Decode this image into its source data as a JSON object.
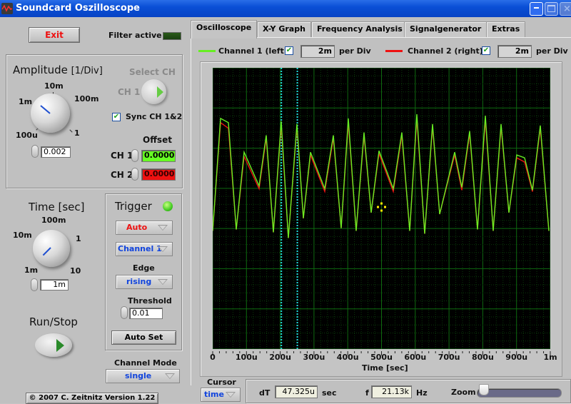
{
  "window": {
    "title": "Soundcard Oszilloscope",
    "minimize_icon": "minimize-icon",
    "maximize_icon": "maximize-icon",
    "close_icon": "close-icon"
  },
  "left_panel": {
    "exit_label": "Exit",
    "filter_label": "Filter active",
    "filter_active": false,
    "amplitude": {
      "title": "Amplitude",
      "unit": "[1/Div]",
      "knob_labels": [
        "100u",
        "1m",
        "10m",
        "100m",
        "1"
      ],
      "value": "0.002"
    },
    "select_ch": {
      "title": "Select CH",
      "value_label": "CH 1"
    },
    "sync": {
      "label": "Sync CH 1&2",
      "checked": true
    },
    "offset": {
      "title": "Offset",
      "ch1_label": "CH 1",
      "ch1_value": "0.0000",
      "ch1_color": "#66ff33",
      "ch2_label": "CH 2",
      "ch2_value": "0.0000",
      "ch2_color": "#ee1111"
    },
    "time": {
      "title": "Time [sec]",
      "knob_labels": [
        "1m",
        "10m",
        "100m",
        "1",
        "10"
      ],
      "value": "1m"
    },
    "trigger": {
      "title": "Trigger",
      "led_on": true,
      "mode": "Auto",
      "source": "Channel 1",
      "edge_label": "Edge",
      "edge": "rising",
      "threshold_label": "Threshold",
      "threshold": "0.01",
      "autoset_label": "Auto Set"
    },
    "run_stop_label": "Run/Stop",
    "channel_mode": {
      "label": "Channel Mode",
      "value": "single"
    },
    "copyright": "© 2007   C. Zeitnitz Version 1.22"
  },
  "tabs": [
    {
      "label": "Oscilloscope",
      "active": true
    },
    {
      "label": "X-Y Graph",
      "active": false
    },
    {
      "label": "Frequency Analysis",
      "active": false
    },
    {
      "label": "Signalgenerator",
      "active": false
    },
    {
      "label": "Extras",
      "active": false
    }
  ],
  "channels": {
    "ch1": {
      "label": "Channel 1 (left)",
      "enabled": true,
      "per_div": "2m",
      "per_div_label": "per Div",
      "color": "#66ee22"
    },
    "ch2": {
      "label": "Channel 2 (right)",
      "enabled": true,
      "per_div": "2m",
      "per_div_label": "per Div",
      "color": "#ee1111"
    }
  },
  "bottom": {
    "cursor_label": "Cursor",
    "cursor_mode": "time",
    "dt_label": "dT",
    "dt_value": "47.325u",
    "dt_unit": "sec",
    "f_label": "f",
    "f_value": "21.13k",
    "f_unit": "Hz",
    "zoom_label": "Zoom",
    "zoom_level": 0
  },
  "chart_data": {
    "type": "line",
    "title": "",
    "xlabel": "Time [sec]",
    "ylabel": "",
    "x_tick_labels": [
      "0",
      "100u",
      "200u",
      "300u",
      "400u",
      "500u",
      "600u",
      "700u",
      "800u",
      "900u",
      "1m"
    ],
    "xlim": [
      0,
      0.001
    ],
    "ylim": [
      -0.01,
      0.01
    ],
    "grid": true,
    "background": "#000000",
    "grid_color": "#0c5a0c",
    "cursors_x": [
      0.0002034,
      0.0002507
    ],
    "cursor_color": "#22dddd",
    "marker": {
      "x": 0.0005,
      "y": 0.0001,
      "color": "#ffee00"
    },
    "x": [
      0,
      2.33e-05,
      4.65e-05,
      6.98e-05,
      9.3e-05,
      0.0001374,
      0.0001586,
      0.0001797,
      0.000203,
      0.0002241,
      0.0002495,
      0.0002685,
      0.0002896,
      0.0003319,
      0.0003573,
      0.0003805,
      0.0004017,
      0.0004249,
      0.0004482,
      0.0004693,
      0.0004926,
      0.0005349,
      0.0005603,
      0.0005835,
      0.0006047,
      0.0006279,
      0.0006512,
      0.0006723,
      0.0007167,
      0.0007378,
      0.0007611,
      0.0007844,
      0.0008076,
      0.0008309,
      0.0008541,
      0.0008774,
      0.0009006,
      0.0009239,
      0.0009472,
      0.0009704,
      0.0009958
    ],
    "series": [
      {
        "name": "Channel 1 (left)",
        "color": "#66ee22",
        "values": [
          -0.0016,
          0.0064,
          0.0061,
          -0.0015,
          0.004,
          0.0016,
          0.0052,
          -0.0017,
          0.0062,
          -0.0021,
          0.006,
          -0.0007,
          0.004,
          0.0014,
          0.0052,
          -0.0014,
          0.0064,
          -0.0016,
          0.0054,
          -0.0003,
          0.0041,
          0.0014,
          0.0054,
          -0.0016,
          0.0067,
          -0.0018,
          0.006,
          -0.0004,
          0.004,
          0.0015,
          0.0055,
          -0.0015,
          0.0066,
          -0.0016,
          0.006,
          -0.0003,
          0.0038,
          0.0036,
          0.0013,
          0.0059,
          -0.0016
        ]
      },
      {
        "name": "Channel 2 (right)",
        "color": "#ee1111",
        "values": [
          -0.0016,
          0.0061,
          0.0057,
          -0.0015,
          0.0037,
          0.0014,
          0.005,
          -0.0017,
          0.0059,
          -0.0021,
          0.0058,
          -0.0007,
          0.0038,
          0.0012,
          0.005,
          -0.0014,
          0.0061,
          -0.0016,
          0.0052,
          -0.0003,
          0.0039,
          0.0012,
          0.0052,
          -0.0016,
          0.0064,
          -0.0018,
          0.0058,
          -0.0004,
          0.0038,
          0.0013,
          0.0053,
          -0.0015,
          0.0063,
          -0.0016,
          0.0058,
          -0.0003,
          0.0036,
          0.0033,
          0.0012,
          0.0057,
          -0.0016
        ]
      }
    ]
  }
}
